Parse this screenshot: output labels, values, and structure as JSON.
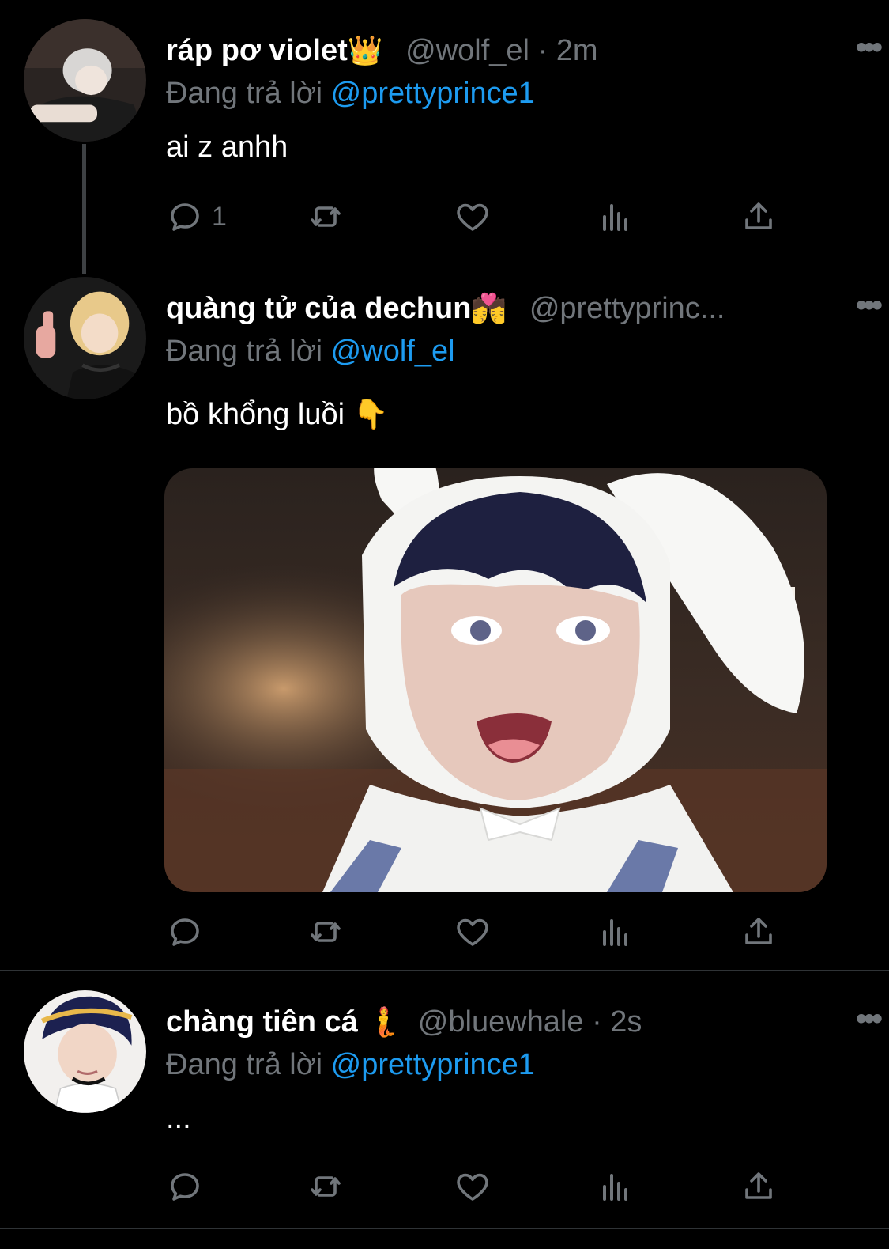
{
  "colors": {
    "background": "#000000",
    "text": "#ffffff",
    "secondary": "#71767b",
    "accent": "#1d9bf0",
    "divider": "#2f3336"
  },
  "tweets": [
    {
      "display_name": "ráp pơ violet",
      "name_emoji": "👑",
      "handle": "@wolf_el",
      "separator": "·",
      "time": "2m",
      "reply_prefix": "Đang trả lời",
      "reply_to": "@prettyprince1",
      "text": "ai z anhh",
      "reply_count": "1",
      "more_label": "•••"
    },
    {
      "display_name": "quàng tử của dechun",
      "name_emoji": "💏",
      "handle": "@prettyprinc...",
      "reply_prefix": "Đang trả lời",
      "reply_to": "@wolf_el",
      "text": "bồ khổng luồi",
      "text_emoji": "👇",
      "reply_count": "",
      "more_label": "•••",
      "has_media": true
    },
    {
      "display_name": "chàng tiên cá",
      "name_emoji": "🧜",
      "handle": "@bluewhale",
      "separator": "·",
      "time": "2s",
      "reply_prefix": "Đang trả lời",
      "reply_to": "@prettyprince1",
      "text": "...",
      "reply_count": "",
      "more_label": "•••"
    }
  ],
  "icons": {
    "reply": "reply-icon",
    "retweet": "retweet-icon",
    "like": "heart-icon",
    "views": "views-icon",
    "share": "share-icon",
    "more": "more-icon"
  }
}
